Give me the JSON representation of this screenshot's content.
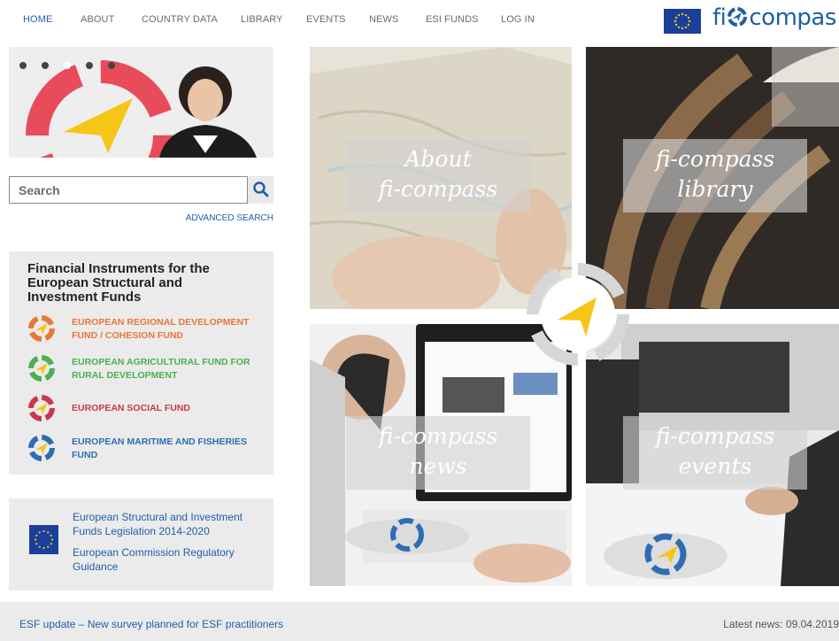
{
  "nav": {
    "items": [
      {
        "label": "HOME"
      },
      {
        "label": "ABOUT"
      },
      {
        "label": "COUNTRY DATA"
      },
      {
        "label": "LIBRARY"
      },
      {
        "label": "EVENTS"
      },
      {
        "label": "NEWS"
      },
      {
        "label": "ESI FUNDS"
      },
      {
        "label": "LOG IN"
      }
    ],
    "active": "HOME"
  },
  "logo": {
    "prefix": "fi",
    "suffix": "compas"
  },
  "search": {
    "placeholder": "Search",
    "advanced_label": "ADVANCED SEARCH",
    "icon": "search-icon"
  },
  "funds": {
    "title": "Financial Instruments for the European Structural and Investment Funds",
    "items": [
      {
        "label": "EUROPEAN REGIONAL DEVELOPMENT FUND / COHESION FUND",
        "color": "#e8773a"
      },
      {
        "label": "EUROPEAN AGRICULTURAL FUND FOR RURAL DEVELOPMENT",
        "color": "#4caf50"
      },
      {
        "label": "EUROPEAN SOCIAL FUND",
        "color": "#c8384e"
      },
      {
        "label": "EUROPEAN MARITIME AND FISHERIES FUND",
        "color": "#2f6db3"
      }
    ]
  },
  "legislation": {
    "links": [
      {
        "label": "European Structural and Investment Funds Legislation 2014-2020"
      },
      {
        "label": "European Commission Regulatory Guidance"
      }
    ]
  },
  "tiles": [
    {
      "line1": "About",
      "line2": "fi-compass"
    },
    {
      "line1": "fi-compass",
      "line2": "library"
    },
    {
      "line1": "fi-compass",
      "line2": "news"
    },
    {
      "line1": "fi-compass",
      "line2": "events"
    }
  ],
  "newsbar": {
    "headline": "ESF update – New survey planned for ESF practitioners",
    "latest": "Latest news: 09.04.2019"
  },
  "colors": {
    "brand_blue": "#1f5fa8",
    "accent_yellow": "#f5c518"
  }
}
